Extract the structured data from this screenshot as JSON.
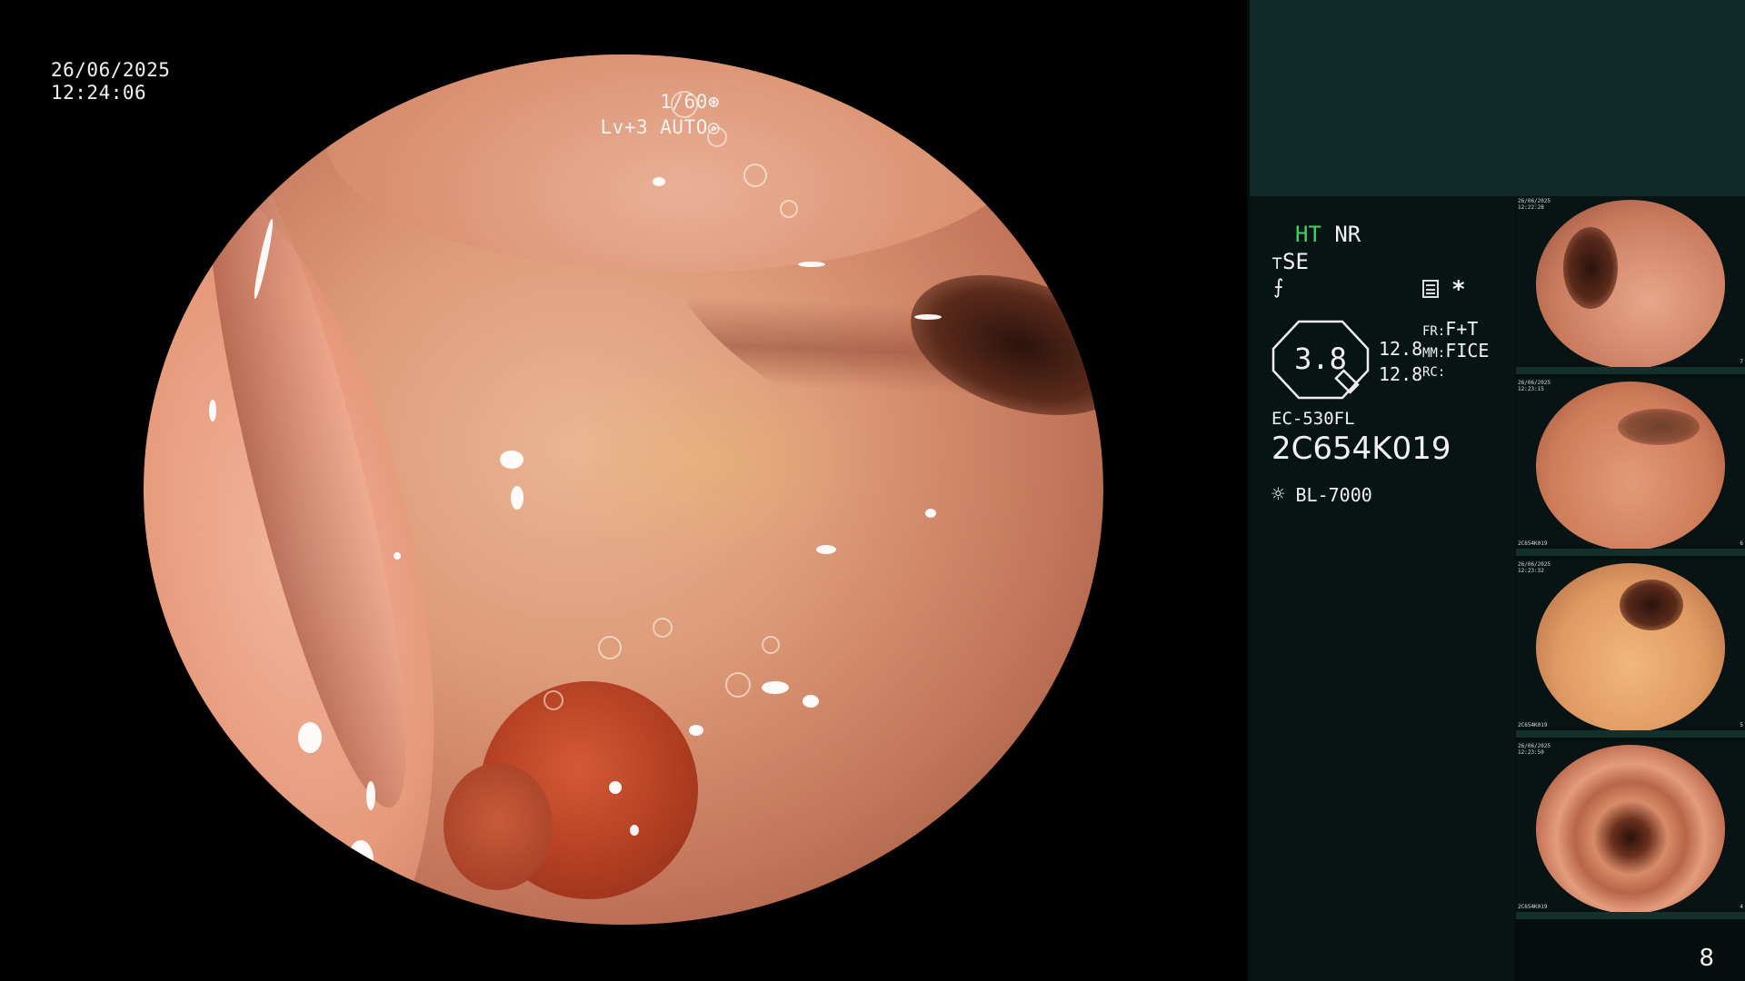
{
  "overlay": {
    "date": "26/06/2025",
    "time": "12:24:06",
    "shutter": "1/60",
    "level": "Lv+3",
    "iris_mode": "AUTO"
  },
  "settings": {
    "ht": "HT",
    "nr": "NR",
    "se": "SE",
    "zoom_value": "3.8",
    "val_a": "12.8",
    "val_b": "12.8",
    "fr_label": "FR:",
    "fr_value": "F+T",
    "mm_label": "MM:",
    "mm_value": "FICE",
    "rc_label": "RC:",
    "scope_model": "EC-530FL",
    "scope_serial": "2C654K019",
    "light_source": "BL-7000",
    "asterisk": "*"
  },
  "thumbnails": [
    {
      "date": "26/06/2025",
      "time": "12:22:28",
      "serial": "2C654K019",
      "index": "7"
    },
    {
      "date": "26/06/2025",
      "time": "12:23:15",
      "serial": "2C654K019",
      "index": "6"
    },
    {
      "date": "26/06/2025",
      "time": "12:23:32",
      "serial": "2C654K019",
      "index": "5"
    },
    {
      "date": "26/06/2025",
      "time": "12:23:50",
      "serial": "2C654K019",
      "index": "4"
    }
  ],
  "image_count": "8",
  "icons": {
    "shutter": "aperture-icon",
    "iris": "iris-icon",
    "se": "enhancement-icon",
    "structure": "structure-icon",
    "memo": "memo-icon",
    "lamp": "lamp-icon"
  },
  "colors": {
    "teal_block": "#0d2a28",
    "panel_bg": "#081414",
    "ht_green": "#41d36a"
  }
}
